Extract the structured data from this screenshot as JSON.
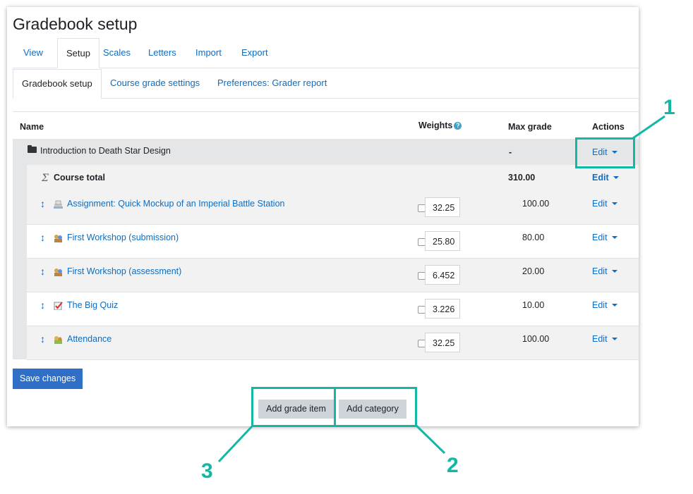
{
  "page": {
    "title": "Gradebook setup"
  },
  "tabs": [
    "View",
    "Setup",
    "Scales",
    "Letters",
    "Import",
    "Export"
  ],
  "subtabs": [
    "Gradebook setup",
    "Course grade settings",
    "Preferences: Grader report"
  ],
  "table": {
    "headers": {
      "name": "Name",
      "weights": "Weights",
      "max_grade": "Max grade",
      "actions": "Actions"
    },
    "category": {
      "name": "Introduction to Death Star Design",
      "max_grade": "-",
      "action": "Edit"
    },
    "total": {
      "name": "Course total",
      "max_grade": "310.00",
      "action": "Edit"
    },
    "items": [
      {
        "name": "Assignment: Quick Mockup of an Imperial Battle Station",
        "weight": "32.25",
        "max_grade": "100.00",
        "action": "Edit",
        "icon": "assignment-icon"
      },
      {
        "name": "First Workshop (submission)",
        "weight": "25.80",
        "max_grade": "80.00",
        "action": "Edit",
        "icon": "workshop-icon"
      },
      {
        "name": "First Workshop (assessment)",
        "weight": "6.452",
        "max_grade": "20.00",
        "action": "Edit",
        "icon": "workshop-icon"
      },
      {
        "name": "The Big Quiz",
        "weight": "3.226",
        "max_grade": "10.00",
        "action": "Edit",
        "icon": "quiz-icon"
      },
      {
        "name": "Attendance",
        "weight": "32.25",
        "max_grade": "100.00",
        "action": "Edit",
        "icon": "attendance-icon"
      }
    ]
  },
  "buttons": {
    "save": "Save changes",
    "add_grade_item": "Add grade item",
    "add_category": "Add category"
  },
  "callouts": [
    "1",
    "2",
    "3"
  ],
  "colors": {
    "link": "#0f6cbf",
    "primary": "#2f6fc6",
    "highlight": "#12b7a6",
    "row_shade": "#f2f2f2"
  }
}
